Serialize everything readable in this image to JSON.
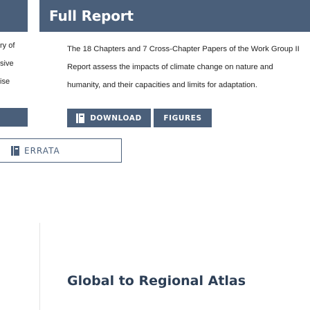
{
  "left_column": {
    "lines": [
      "ry of",
      "sive",
      "ise"
    ]
  },
  "full_report": {
    "title": "Full Report",
    "description": "The 18 Chapters and 7 Cross-Chapter Papers of the Work Group II Report assess the impacts of climate change on nature and humanity, and their capacities and limits for adaptation.",
    "download_label": "DOWNLOAD",
    "figures_label": "FIGURES"
  },
  "errata": {
    "label": "ERRATA"
  },
  "atlas": {
    "title": "Global to Regional Atlas"
  },
  "colors": {
    "brand": "#4a5f7a",
    "heading": "#2c3e55"
  },
  "icons": {
    "download": "book-icon",
    "errata": "book-icon"
  }
}
